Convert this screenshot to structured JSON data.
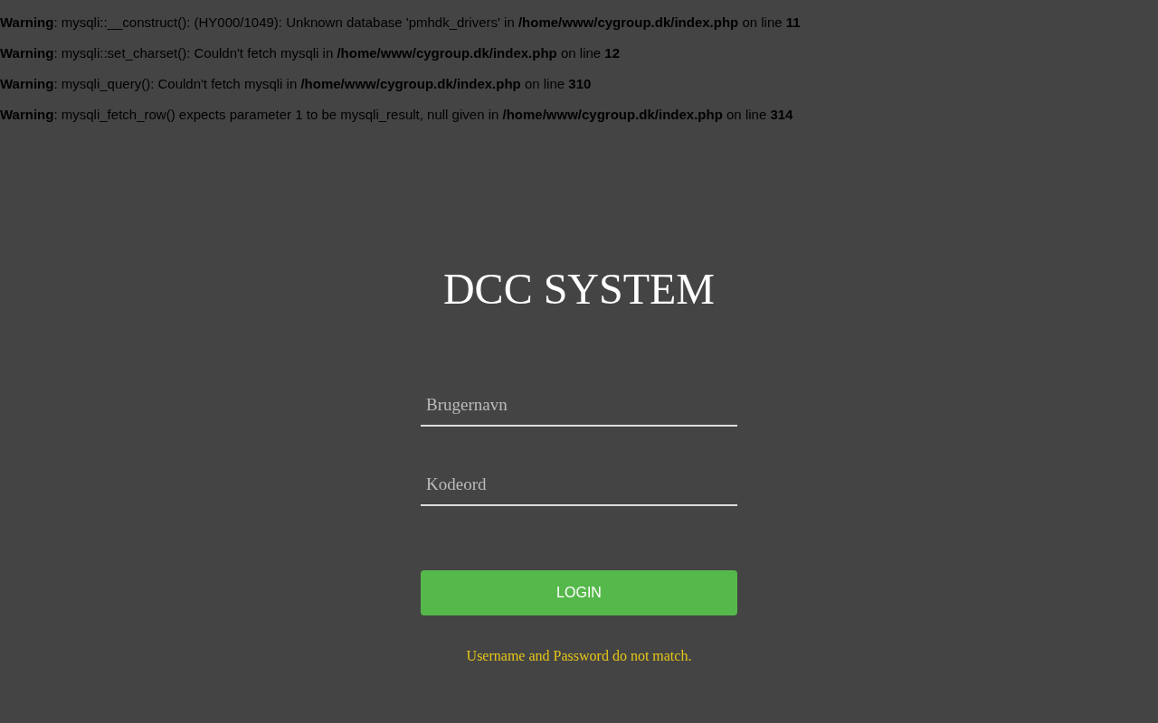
{
  "warnings": [
    "**Warning**: mysqli::__construct(): (HY000/1049): Unknown database 'pmhdk_drivers' in **/home/www/cygroup.dk/index.php** on line **11**",
    "**Warning**: mysqli::set_charset(): Couldn't fetch mysqli in **/home/www/cygroup.dk/index.php** on line **12**",
    "**Warning**: mysqli_query(): Couldn't fetch mysqli in **/home/www/cygroup.dk/index.php** on line **310**",
    "**Warning**: mysqli_fetch_row() expects parameter 1 to be mysqli_result, null given in **/home/www/cygroup.dk/index.php** on line **314**"
  ],
  "login": {
    "title": "DCC SYSTEM",
    "fields": [
      {
        "placeholder": "Brugernavn"
      },
      {
        "placeholder": "Kodeord"
      }
    ],
    "button": "LOGIN",
    "error": "Username and Password do not match."
  }
}
